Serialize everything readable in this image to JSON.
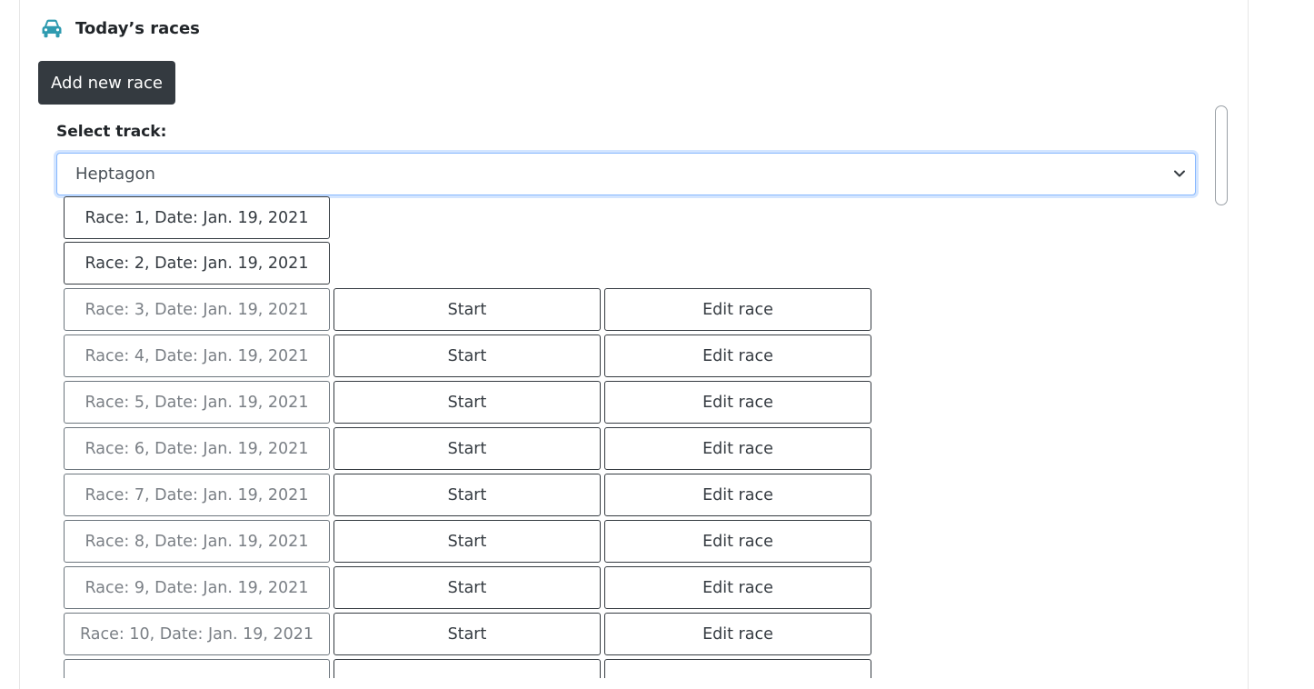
{
  "header": {
    "title": "Today’s races",
    "icon": "car-icon",
    "icon_color": "#2f9bb0"
  },
  "toolbar": {
    "add_label": "Add new race"
  },
  "track": {
    "label": "Select track:",
    "selected": "Heptagon"
  },
  "races": [
    {
      "label": "Race: 1, Date: Jan. 19, 2021",
      "active": true
    },
    {
      "label": "Race: 2, Date: Jan. 19, 2021",
      "active": true
    },
    {
      "label": "Race: 3, Date: Jan. 19, 2021",
      "active": false,
      "start": "Start",
      "edit": "Edit race"
    },
    {
      "label": "Race: 4, Date: Jan. 19, 2021",
      "active": false,
      "start": "Start",
      "edit": "Edit race"
    },
    {
      "label": "Race: 5, Date: Jan. 19, 2021",
      "active": false,
      "start": "Start",
      "edit": "Edit race"
    },
    {
      "label": "Race: 6, Date: Jan. 19, 2021",
      "active": false,
      "start": "Start",
      "edit": "Edit race"
    },
    {
      "label": "Race: 7, Date: Jan. 19, 2021",
      "active": false,
      "start": "Start",
      "edit": "Edit race"
    },
    {
      "label": "Race: 8, Date: Jan. 19, 2021",
      "active": false,
      "start": "Start",
      "edit": "Edit race"
    },
    {
      "label": "Race: 9, Date: Jan. 19, 2021",
      "active": false,
      "start": "Start",
      "edit": "Edit race"
    },
    {
      "label": "Race: 10, Date: Jan. 19, 2021",
      "active": false,
      "start": "Start",
      "edit": "Edit race"
    }
  ]
}
